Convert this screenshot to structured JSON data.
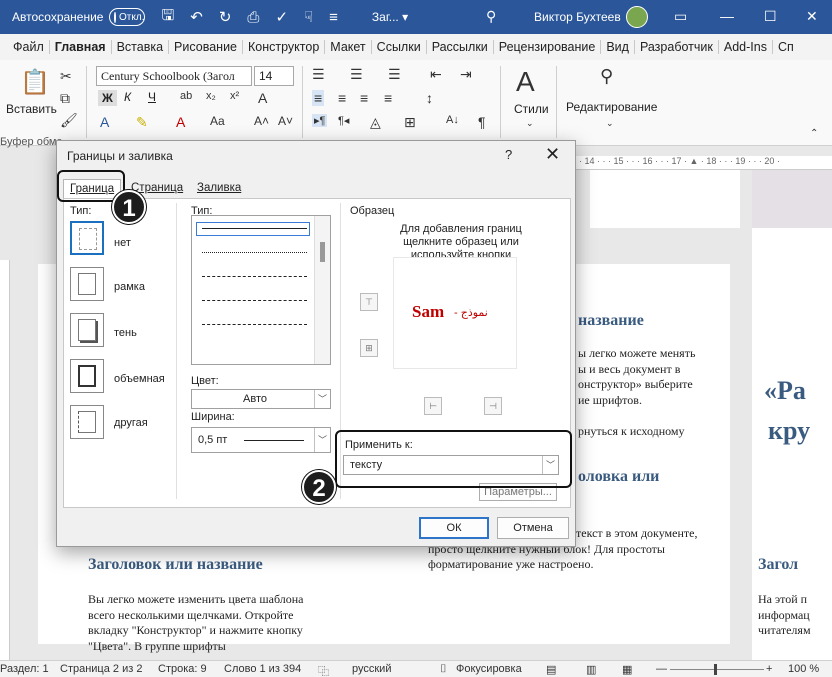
{
  "titlebar": {
    "autosave_label": "Автосохранение",
    "autosave_state": "Откл.",
    "doc_name": "Заг... ▾",
    "user_name": "Виктор Бухтеев"
  },
  "ribbon_tabs": [
    "Файл",
    "Главная",
    "Вставка",
    "Рисование",
    "Конструктор",
    "Макет",
    "Ссылки",
    "Рассылки",
    "Рецензирование",
    "Вид",
    "Разработчик",
    "Add-Ins",
    "Сп"
  ],
  "ribbon": {
    "paste_label": "Вставить",
    "clipboard_group": "Буфер обме",
    "font_name": "Century Schoolbook (Загол",
    "font_size": "14",
    "styles_label": "Стили",
    "editing_label": "Редактирование",
    "bold": "Ж",
    "italic": "К",
    "underline": "Ч"
  },
  "ruler_text": "· 14 · · · 15 · · · 16 · · · 17 · ▲ · 18 · · · 19 · · · 20 ·",
  "dialog": {
    "title": "Границы и заливка",
    "help": "?",
    "close": "✕",
    "tabs": [
      "Граница",
      "Страница",
      "Заливка"
    ],
    "type_label": "Тип:",
    "presets": [
      "нет",
      "рамка",
      "тень",
      "объемная",
      "другая"
    ],
    "style_label": "Тип:",
    "color_label": "Цвет:",
    "color_value": "Авто",
    "width_label": "Ширина:",
    "width_value": "0,5 пт",
    "preview_title": "Образец",
    "preview_hint": "Для добавления границ щелкните образец или используйте кнопки",
    "sample_text": "Sam",
    "sample_rtl": "- نموذج",
    "apply_label": "Применить к:",
    "apply_value": "тексту",
    "params_button": "Параметры...",
    "ok": "ОК",
    "cancel": "Отмена"
  },
  "callouts": [
    "1",
    "2"
  ],
  "document": {
    "right_heading_1": "название",
    "right_par_1": [
      "ы легко можете менять",
      "ы и весь документ в",
      "онструктор» выберите",
      "ие шрифтов."
    ],
    "right_par_2": "рнуться к исходному",
    "right_heading_2": "оловка или",
    "right_par_3": [
      "текст в этом документе,",
      "просто щелкните нужный блок! Для простоты",
      "форматирование уже настроено."
    ],
    "left_heading": "Заголовок или название",
    "left_par": [
      "Вы легко можете изменить цвета шаблона",
      "всего несколькими щелчками. Откройте",
      "вкладку \"Конструктор\" и нажмите кнопку",
      "\"Цвета\". В группе шрифты"
    ],
    "far_quote": "«Ра",
    "far_quote2": "кру",
    "far_heading": "Загол",
    "far_par": [
      "На этой п",
      "информац",
      "читателям"
    ]
  },
  "statusbar": {
    "section": "Раздел: 1",
    "page": "Страница 2 из 2",
    "line": "Строка: 9",
    "words": "Слово 1 из 394",
    "language": "русский",
    "focus": "Фокусировка",
    "zoom": "100 %"
  }
}
